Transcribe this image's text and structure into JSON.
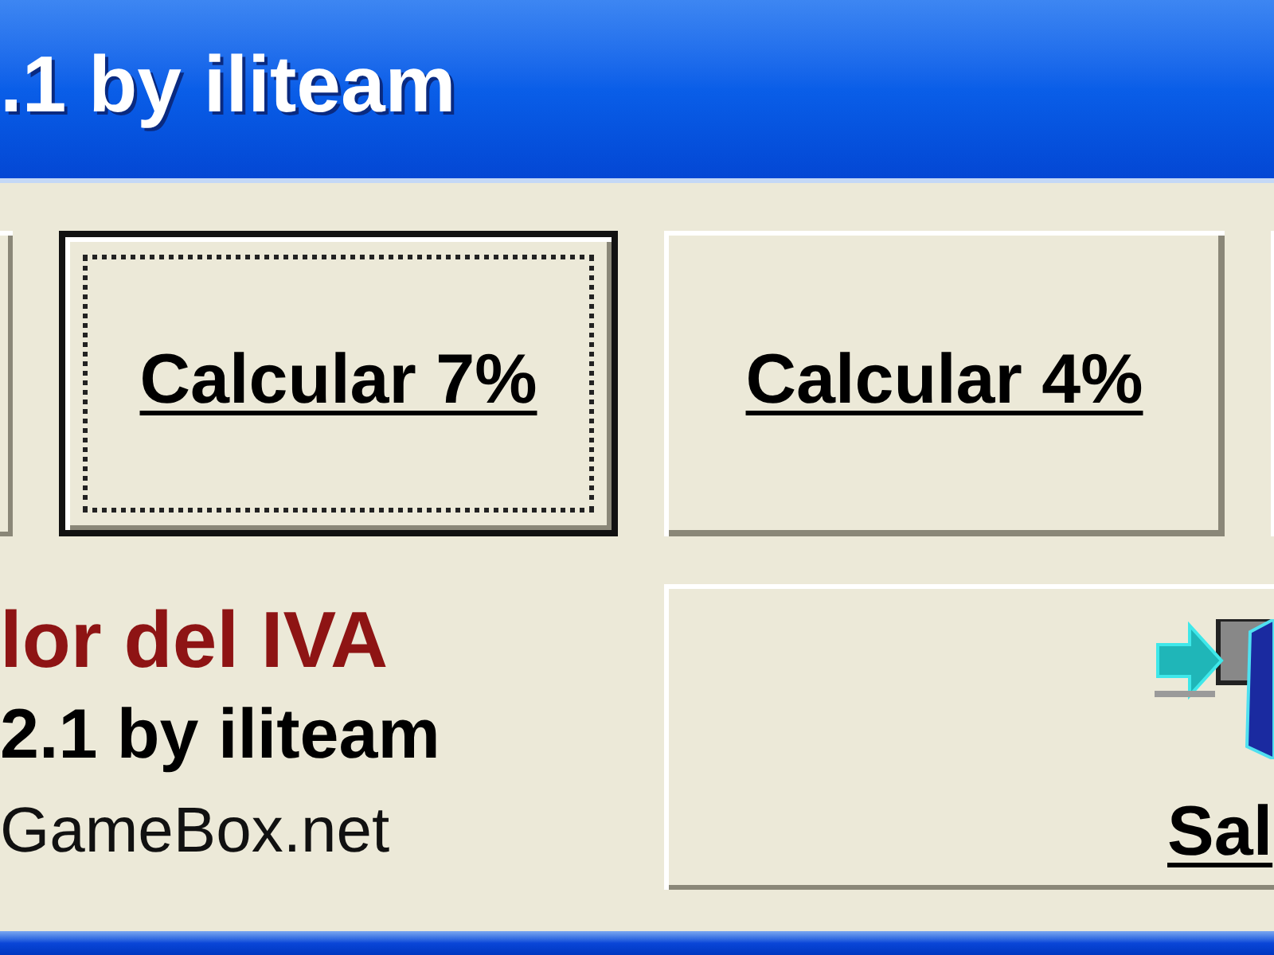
{
  "window": {
    "title": ".1 by iliteam"
  },
  "top_buttons": [
    {
      "kind": "clipped"
    },
    {
      "kind": "button",
      "label": "Calcular 7%",
      "focused": true
    },
    {
      "kind": "button",
      "label": "Calcular 4%",
      "focused": false
    },
    {
      "kind": "clipped"
    }
  ],
  "info_lines": [
    {
      "kind": "heading",
      "text": "lor del IVA"
    },
    {
      "kind": "version",
      "text": "2.1 by iliteam"
    },
    {
      "kind": "site",
      "text": "GameBox.net"
    }
  ],
  "exit_button": {
    "label": "Sal"
  }
}
